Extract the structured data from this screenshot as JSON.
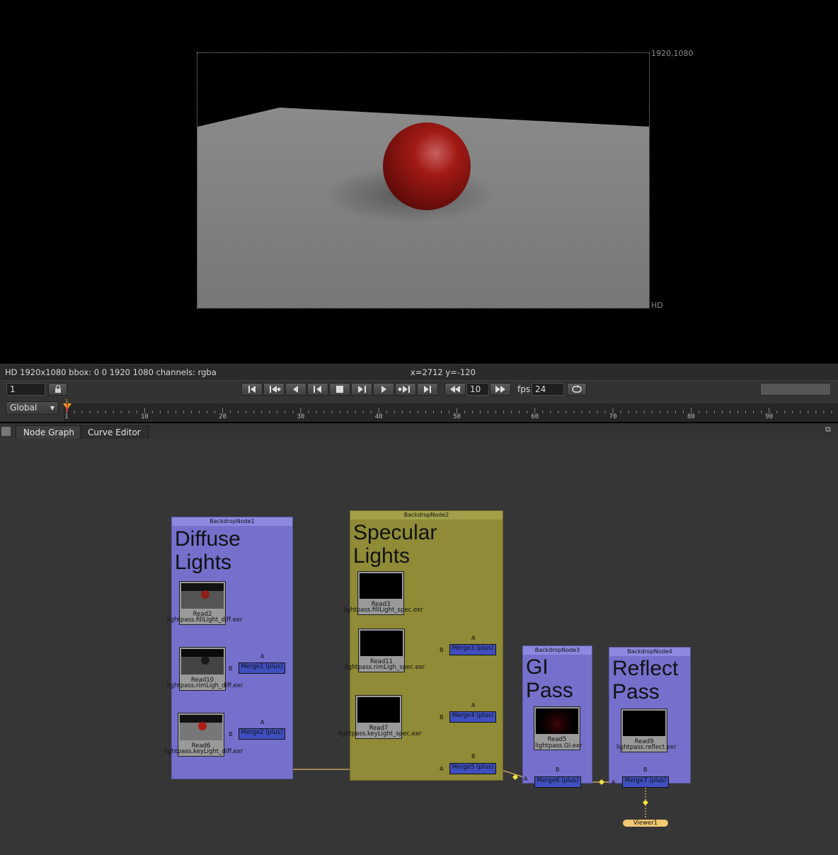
{
  "viewer": {
    "format_size": "1920,1080",
    "format_name": "HD"
  },
  "infobar": {
    "left": "HD 1920x1080 bbox: 0 0 1920 1080 channels: rgba",
    "coords": "x=2712 y=-120"
  },
  "transport": {
    "frame": "1",
    "increment": "10",
    "fps_label": "fps",
    "fps": "24"
  },
  "timeline": {
    "range_mode": "Global",
    "current_frame": "1",
    "ticks": [
      "1",
      "10",
      "20",
      "30",
      "40",
      "50",
      "60",
      "70",
      "80",
      "90",
      "1"
    ]
  },
  "tabs": [
    "Node Graph",
    "Curve Editor"
  ],
  "nodes": {
    "backdrop1": {
      "title": "BackdropNode1",
      "label_line1": "Diffuse",
      "label_line2": "Lights"
    },
    "backdrop2": {
      "title": "BackdropNode2",
      "label_line1": "Specular",
      "label_line2": "Lights"
    },
    "backdrop3": {
      "title": "BackdropNode3",
      "label_line1": "GI",
      "label_line2": "Pass"
    },
    "backdrop4": {
      "title": "BackdropNode4",
      "label_line1": "Reflect",
      "label_line2": "Pass"
    },
    "read2": {
      "name": "Read2",
      "file": "lightpass.fillLight_diff.exr"
    },
    "read10": {
      "name": "Read10",
      "file": "lightpass.rimLigh_diff.exr"
    },
    "read6": {
      "name": "Read6",
      "file": "lightpass.keyLight_diff.exr"
    },
    "read3": {
      "name": "Read3",
      "file": "lightpass.fillLight_spec.exr"
    },
    "read11": {
      "name": "Read11",
      "file": "lightpass.rimLigh_spec.exr"
    },
    "read7": {
      "name": "Read7",
      "file": "lightpass.keyLight_spec.exr"
    },
    "read5": {
      "name": "Read5",
      "file": "lightpass.GI.exr"
    },
    "read9": {
      "name": "Read9",
      "file": "lightpass.reflect.exr"
    },
    "merge1": "Merge1 (plus)",
    "merge2": "Merge2 (plus)",
    "merge3": "Merge3 (plus)",
    "merge4": "Merge4 (plus)",
    "merge5": "Merge5 (plus)",
    "merge6": "Merge6 (plus)",
    "merge7": "Merge7 (plus)",
    "viewer1": "Viewer1"
  },
  "colors": {
    "diffuse_backdrop": "#7570cc",
    "specular_backdrop": "#8f8b36",
    "merge_node": "#3f4fbf",
    "viewer_node": "#f2c873",
    "pipe": "#e0b56a"
  }
}
